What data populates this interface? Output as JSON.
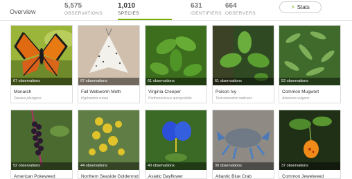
{
  "tabs": {
    "overview": "Overview",
    "observations": {
      "count": "5,575",
      "label": "OBSERVATIONS"
    },
    "species": {
      "count": "1,010",
      "label": "SPECIES"
    },
    "identifiers": {
      "count": "631",
      "label": "IDENTIFIERS"
    },
    "observers": {
      "count": "664",
      "label": "OBSERVERS"
    }
  },
  "stats_button": {
    "label": "Stats",
    "icon": "lightning-bolt-icon"
  },
  "accent_color": "#74ac00",
  "species": [
    {
      "observations": "67 observations",
      "common_name": "Monarch",
      "scientific_name": "Danaus plexippus"
    },
    {
      "observations": "67 observations",
      "common_name": "Fall Webworm Moth",
      "scientific_name": "Hyphantria cunea"
    },
    {
      "observations": "61 observations",
      "common_name": "Virginia Creeper",
      "scientific_name": "Parthenocissus quinquefolia"
    },
    {
      "observations": "61 observations",
      "common_name": "Poison Ivy",
      "scientific_name": "Toxicodendron radicans"
    },
    {
      "observations": "53 observations",
      "common_name": "Common Mugwort",
      "scientific_name": "Artemisia vulgaris"
    },
    {
      "observations": "52 observations",
      "common_name": "American Pokeweed",
      "scientific_name": ""
    },
    {
      "observations": "44 observations",
      "common_name": "Northern Seaside Goldenrod",
      "scientific_name": ""
    },
    {
      "observations": "40 observations",
      "common_name": "Asiatic Dayflower",
      "scientific_name": ""
    },
    {
      "observations": "39 observations",
      "common_name": "Atlantic Blue Crab",
      "scientific_name": ""
    },
    {
      "observations": "37 observations",
      "common_name": "Common Jewelweed",
      "scientific_name": ""
    }
  ]
}
